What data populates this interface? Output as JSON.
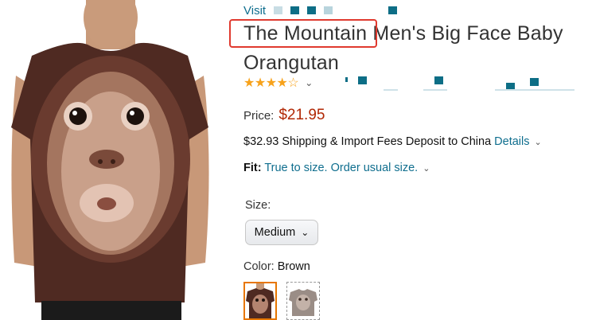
{
  "header": {
    "visit_link": "Visit"
  },
  "product": {
    "title_brand": "The Mountain",
    "title_rest": " Men's Big Face Baby Orangutan",
    "rating_stars": "★★★★☆",
    "rating_value": 4.5
  },
  "price": {
    "label": "Price:",
    "value": "$21.95"
  },
  "shipping": {
    "text": "$32.93 Shipping & Import Fees Deposit to China ",
    "details_link": "Details"
  },
  "fit": {
    "label": "Fit:",
    "value": "True to size. Order usual size."
  },
  "size": {
    "label": "Size:",
    "selected": "Medium"
  },
  "color": {
    "label": "Color: ",
    "value": "Brown"
  },
  "colors": {
    "link": "#0f6e8e",
    "price": "#b12704",
    "star": "#f7a21b",
    "highlight": "#e03a2f",
    "swatch_selected": "#e77600"
  },
  "icons": [
    "star-icon",
    "chevron-down-icon",
    "dropdown-caret-icon"
  ]
}
